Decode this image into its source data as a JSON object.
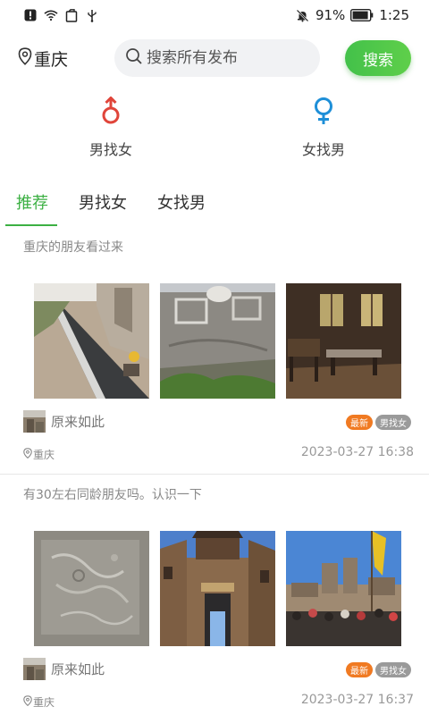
{
  "status_bar": {
    "battery": "91%",
    "time": "1:25",
    "left_icons": [
      "alert-icon",
      "wifi-icon",
      "clipboard-icon",
      "usb-icon"
    ],
    "right_icons": [
      "mute-bell-icon",
      "battery-icon"
    ]
  },
  "header": {
    "location": "重庆",
    "search_placeholder": "搜索所有发布",
    "search_button": "搜索"
  },
  "gender": {
    "male": {
      "label": "男找女",
      "color": "#e0453a"
    },
    "female": {
      "label": "女找男",
      "color": "#1e8fd8"
    }
  },
  "tabs": [
    {
      "label": "推荐",
      "active": true
    },
    {
      "label": "男找女",
      "active": false
    },
    {
      "label": "女找男",
      "active": false
    }
  ],
  "accent_color": "#3cb043",
  "posts": [
    {
      "title": "重庆的朋友看过来",
      "author": "原来如此",
      "badge_new": "最新",
      "badge_category": "男找女",
      "city": "重庆",
      "time": "2023-03-27 16:38",
      "images": [
        "street-construction-photo",
        "carved-stone-wall-photo",
        "old-room-interior-photo"
      ]
    },
    {
      "title": "有30左右同龄朋友吗。认识一下",
      "author": "原来如此",
      "badge_new": "最新",
      "badge_category": "男找女",
      "city": "重庆",
      "time": "2023-03-27 16:37",
      "images": [
        "stone-carving-photo",
        "ancient-gate-tower-photo",
        "old-town-crowd-photo"
      ]
    }
  ]
}
